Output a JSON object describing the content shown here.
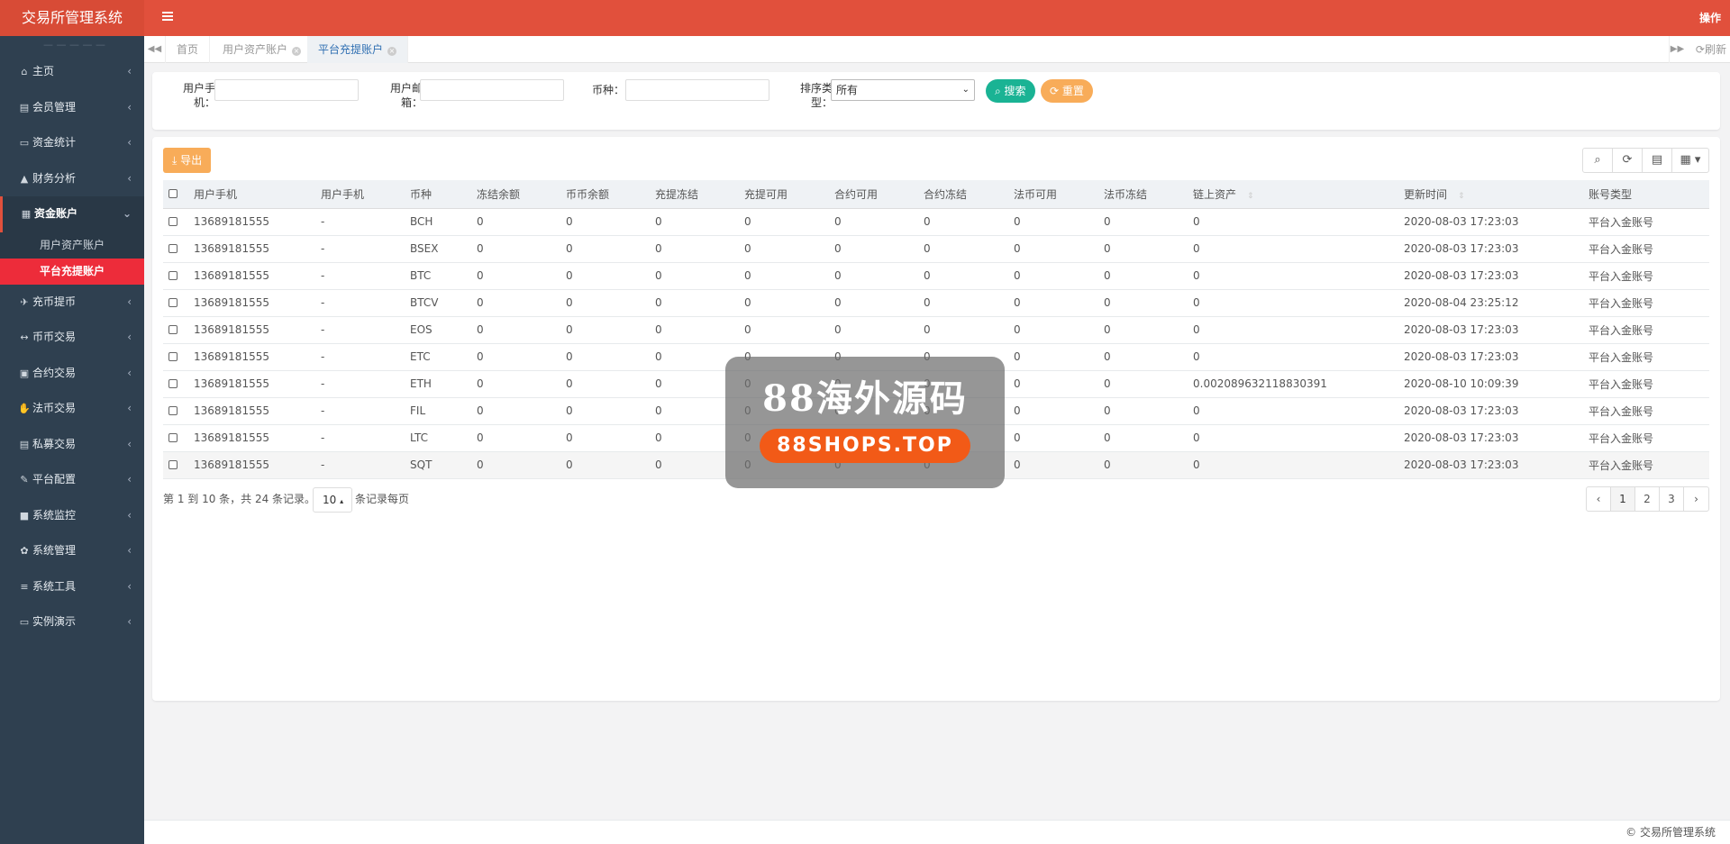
{
  "app": {
    "title": "交易所管理系统",
    "top_right": "操作"
  },
  "sidebar": {
    "ghost_text": "— — — — —",
    "items": [
      {
        "icon": "⌂",
        "icon_name": "home-icon",
        "label": "主页"
      },
      {
        "icon": "▤",
        "icon_name": "member-icon",
        "label": "会员管理"
      },
      {
        "icon": "▭",
        "icon_name": "money-icon",
        "label": "资金统计"
      },
      {
        "icon": "▲",
        "icon_name": "chart-icon",
        "label": "财务分析"
      },
      {
        "icon": "▦",
        "icon_name": "calculator-icon",
        "label": "资金账户",
        "active": true
      },
      {
        "icon": "✈",
        "icon_name": "plane-icon",
        "label": "充币提币"
      },
      {
        "icon": "↔",
        "icon_name": "exchange-icon",
        "label": "币币交易"
      },
      {
        "icon": "▣",
        "icon_name": "contract-icon",
        "label": "合约交易"
      },
      {
        "icon": "✋",
        "icon_name": "handshake-icon",
        "label": "法币交易"
      },
      {
        "icon": "▤",
        "icon_name": "private-icon",
        "label": "私募交易"
      },
      {
        "icon": "✎",
        "icon_name": "config-icon",
        "label": "平台配置"
      },
      {
        "icon": "■",
        "icon_name": "video-icon",
        "label": "系统监控"
      },
      {
        "icon": "✿",
        "icon_name": "gear-icon",
        "label": "系统管理"
      },
      {
        "icon": "≡",
        "icon_name": "bars-icon",
        "label": "系统工具"
      },
      {
        "icon": "▭",
        "icon_name": "desktop-icon",
        "label": "实例演示"
      }
    ],
    "submenu": [
      "用户资产账户",
      "平台充提账户"
    ]
  },
  "tabs": {
    "items": [
      {
        "label": "首页"
      },
      {
        "label": "用户资产账户",
        "close": "×"
      },
      {
        "label": "平台充提账户",
        "close": "×",
        "active": true
      }
    ],
    "refresh": "刷新"
  },
  "search": {
    "phone_label": "用户手机：",
    "email_label": "用户邮箱：",
    "coin_label": "币种：",
    "sort_label": "排序类型：",
    "sort_value": "所有",
    "search_btn": "搜索",
    "reset_btn": "重置"
  },
  "table": {
    "export_btn": "导出",
    "columns": [
      "用户手机",
      "用户手机",
      "币种",
      "冻结余额",
      "币币余额",
      "充提冻结",
      "充提可用",
      "合约可用",
      "合约冻结",
      "法币可用",
      "法币冻结",
      "链上资产",
      "更新时间",
      "账号类型"
    ],
    "rows": [
      [
        "13689181555",
        "-",
        "BCH",
        "0",
        "0",
        "0",
        "0",
        "0",
        "0",
        "0",
        "0",
        "0",
        "2020-08-03 17:23:03",
        "平台入金账号"
      ],
      [
        "13689181555",
        "-",
        "BSEX",
        "0",
        "0",
        "0",
        "0",
        "0",
        "0",
        "0",
        "0",
        "0",
        "2020-08-03 17:23:03",
        "平台入金账号"
      ],
      [
        "13689181555",
        "-",
        "BTC",
        "0",
        "0",
        "0",
        "0",
        "0",
        "0",
        "0",
        "0",
        "0",
        "2020-08-03 17:23:03",
        "平台入金账号"
      ],
      [
        "13689181555",
        "-",
        "BTCV",
        "0",
        "0",
        "0",
        "0",
        "0",
        "0",
        "0",
        "0",
        "0",
        "2020-08-04 23:25:12",
        "平台入金账号"
      ],
      [
        "13689181555",
        "-",
        "EOS",
        "0",
        "0",
        "0",
        "0",
        "0",
        "0",
        "0",
        "0",
        "0",
        "2020-08-03 17:23:03",
        "平台入金账号"
      ],
      [
        "13689181555",
        "-",
        "ETC",
        "0",
        "0",
        "0",
        "0",
        "0",
        "0",
        "0",
        "0",
        "0",
        "2020-08-03 17:23:03",
        "平台入金账号"
      ],
      [
        "13689181555",
        "-",
        "ETH",
        "0",
        "0",
        "0",
        "0",
        "0",
        "0",
        "0",
        "0",
        "0.002089632118830391",
        "2020-08-10 10:09:39",
        "平台入金账号"
      ],
      [
        "13689181555",
        "-",
        "FIL",
        "0",
        "0",
        "0",
        "0",
        "0",
        "0",
        "0",
        "0",
        "0",
        "2020-08-03 17:23:03",
        "平台入金账号"
      ],
      [
        "13689181555",
        "-",
        "LTC",
        "0",
        "0",
        "0",
        "0",
        "0",
        "0",
        "0",
        "0",
        "0",
        "2020-08-03 17:23:03",
        "平台入金账号"
      ],
      [
        "13689181555",
        "-",
        "SQT",
        "0",
        "0",
        "0",
        "0",
        "0",
        "0",
        "0",
        "0",
        "0",
        "2020-08-03 17:23:03",
        "平台入金账号"
      ]
    ],
    "pager_info": "第 1 到 10 条，共 24 条记录。",
    "page_size": "10",
    "pager_tail": "条记录每页",
    "pages": [
      "‹",
      "1",
      "2",
      "3",
      "›"
    ],
    "current_page": "1"
  },
  "watermark": {
    "title": "88海外源码",
    "url": "88SHOPS.TOP"
  },
  "footer": "© 交易所管理系统"
}
